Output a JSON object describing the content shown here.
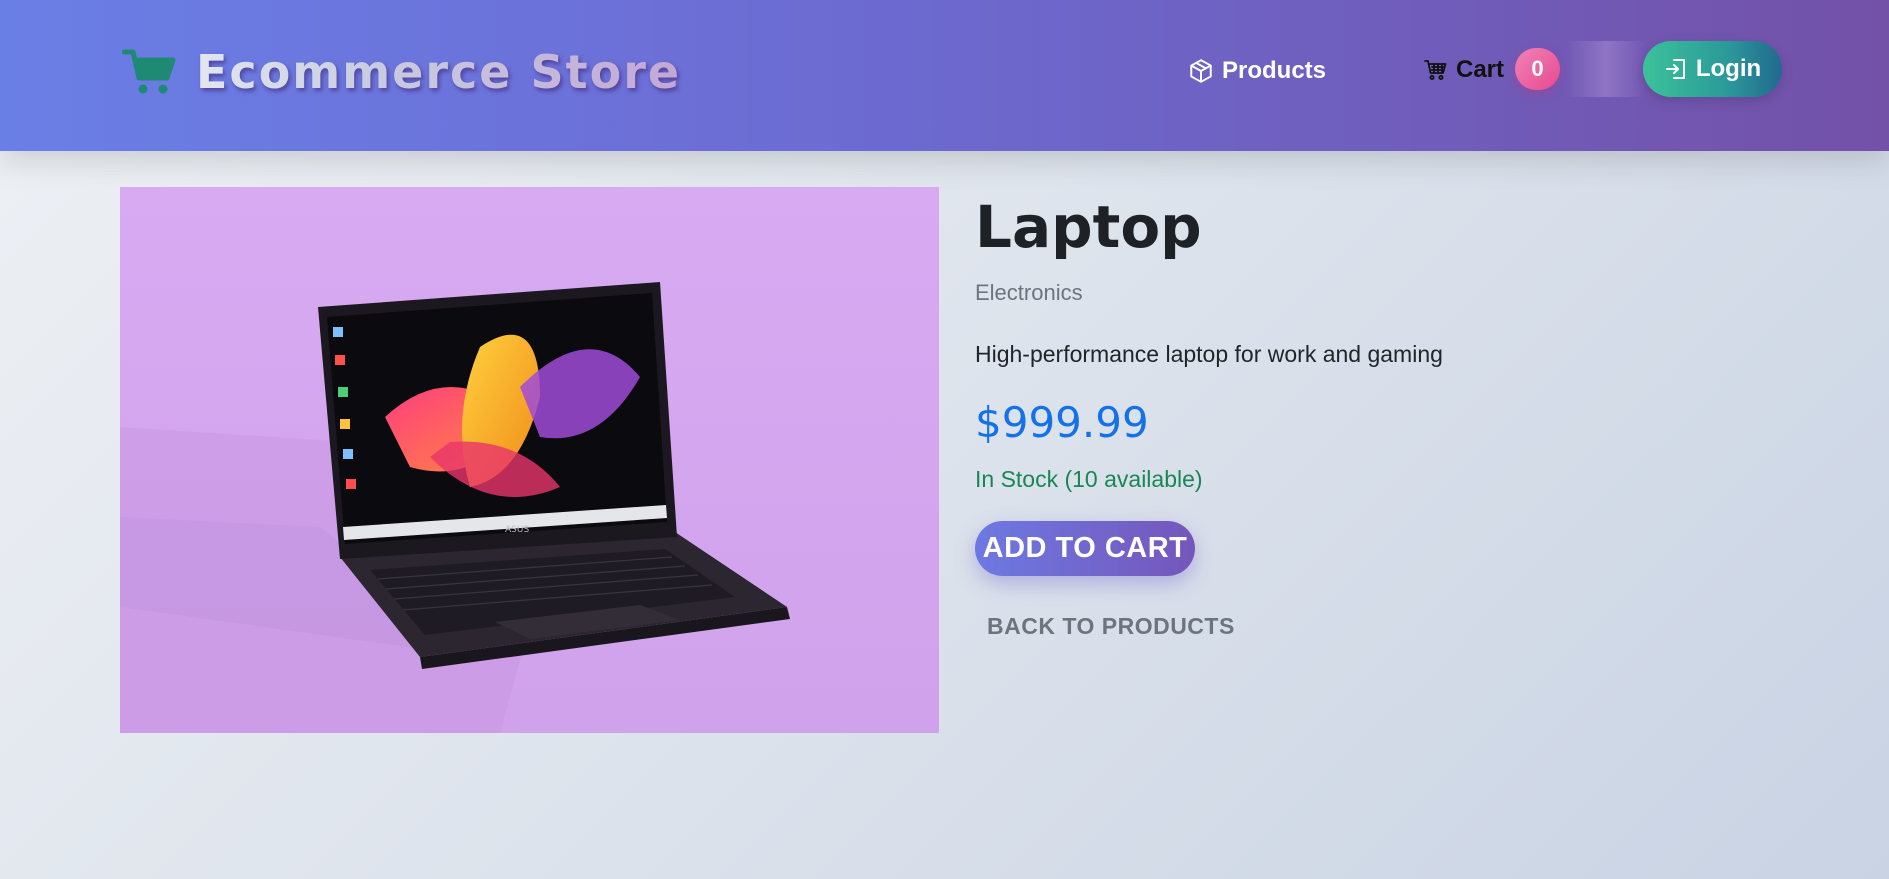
{
  "header": {
    "brand_name": "Ecommerce Store",
    "brand_icon": "shopping-cart-icon",
    "nav": {
      "products_label": "Products",
      "products_icon": "box-icon",
      "cart_label": "Cart",
      "cart_icon": "cart-icon",
      "cart_count": "0"
    },
    "login_label": "Login",
    "login_icon": "login-icon"
  },
  "product": {
    "image_alt": "Laptop",
    "name": "Laptop",
    "category": "Electronics",
    "description": "High-performance laptop for work and gaming",
    "price": "$999.99",
    "stock": "In Stock (10 available)",
    "add_to_cart_label": "ADD TO CART",
    "back_label": "BACK TO PRODUCTS"
  },
  "colors": {
    "header_gradient_start": "#6a7fe6",
    "header_gradient_end": "#7351a8",
    "price": "#1471e8",
    "stock": "#198754",
    "badge": "#e6498f",
    "login_button": "#3cc29a"
  }
}
